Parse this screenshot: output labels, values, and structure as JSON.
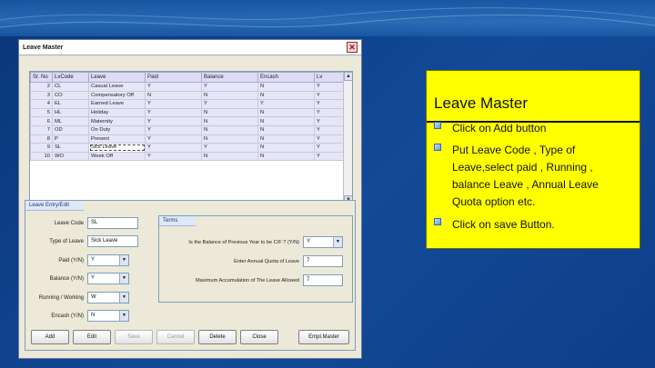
{
  "window": {
    "title": "Leave Master"
  },
  "grid": {
    "columns": [
      "Sr. No",
      "LvCode",
      "Leave",
      "Paid",
      "Balance",
      "Encash",
      "Lv"
    ],
    "rows": [
      [
        "2",
        "CL",
        "Casual Leave",
        "Y",
        "Y",
        "N",
        "Y"
      ],
      [
        "3",
        "CO",
        "Compensatory Off",
        "N",
        "N",
        "N",
        "Y"
      ],
      [
        "4",
        "EL",
        "Earned Leave",
        "Y",
        "Y",
        "Y",
        "Y"
      ],
      [
        "5",
        "HL",
        "Holiday",
        "Y",
        "N",
        "N",
        "Y"
      ],
      [
        "6",
        "ML",
        "Maternity",
        "Y",
        "N",
        "N",
        "Y"
      ],
      [
        "7",
        "OD",
        "On Duty",
        "Y",
        "N",
        "N",
        "Y"
      ],
      [
        "8",
        "P",
        "Present",
        "Y",
        "N",
        "N",
        "Y"
      ],
      [
        "9",
        "SL",
        "Sick Leave",
        "Y",
        "Y",
        "N",
        "Y"
      ],
      [
        "10",
        "WO",
        "Week Off",
        "Y",
        "N",
        "N",
        "Y"
      ]
    ]
  },
  "entry": {
    "group_title": "Leave Entry/Edit",
    "leave_code_label": "Leave Code",
    "leave_code_value": "SL",
    "type_label": "Type of Leave",
    "type_value": "Sick Leave",
    "paid_label": "Paid (Y/N)",
    "paid_value": "Y",
    "balance_label": "Balance (Y/N)",
    "balance_value": "Y",
    "running_label": "Running / Working",
    "running_value": "W",
    "encash_label": "Encash (Y/N)",
    "encash_value": "N"
  },
  "terms": {
    "group_title": "Terms",
    "carry_label": "Is the Balance of Previous Year to be C/F ? (Y/N)",
    "carry_value": "Y",
    "quota_label": "Enter Annual Quota of Leave",
    "quota_value": "7",
    "max_label": "Maximum Accumulation of The Leave Allowed",
    "max_value": "7"
  },
  "buttons": {
    "add": "Add",
    "edit": "Edit",
    "save": "Save",
    "cancel": "Cancel",
    "delete": "Delete",
    "close": "Close",
    "empl_master": "Empl.Master"
  },
  "callout": {
    "title": "Leave Master",
    "bullets": [
      "Click on Add button",
      "Put Leave Code , Type of Leave,select paid , Running , balance Leave , Annual Leave Quota option etc.",
      "Click on save Button."
    ]
  },
  "colors": {
    "callout_bg": "#ffff00",
    "slide_bg": "#0f3f86"
  }
}
